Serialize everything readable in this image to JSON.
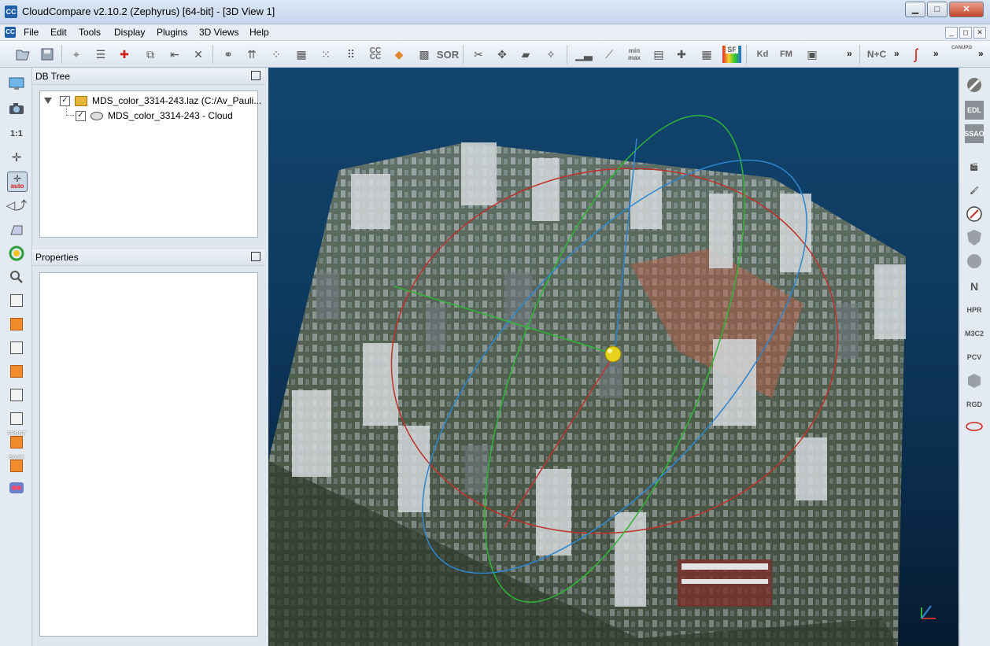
{
  "window": {
    "title": "CloudCompare v2.10.2 (Zephyrus) [64-bit] - [3D View 1]",
    "logo_text": "CC",
    "minimize": "▁",
    "maximize": "□",
    "close": "✕"
  },
  "menu": {
    "items": [
      "File",
      "Edit",
      "Tools",
      "Display",
      "Plugins",
      "3D Views",
      "Help"
    ],
    "mdi_minimize": "_",
    "mdi_restore": "◻",
    "mdi_close": "✕"
  },
  "toolbar": {
    "ccc_label": "CC CC",
    "sor_label": "SOR",
    "minmax_label": "min max",
    "sf_label": "SF",
    "kd_label": "Kd",
    "fm_label": "FM",
    "nc_label": "N+C",
    "canupo_label": "CANUPO",
    "more": "»"
  },
  "left_toolbar": {
    "ratio_label": "1:1",
    "auto_label": "auto",
    "front_label": "FRONT",
    "back_label": "BACK"
  },
  "db_tree": {
    "title": "DB Tree",
    "root": {
      "label": "MDS_color_3314-243.laz (C:/Av_Pauli...",
      "checked": true
    },
    "child": {
      "label": "MDS_color_3314-243 - Cloud",
      "checked": true
    }
  },
  "properties": {
    "title": "Properties"
  },
  "right_toolbar": {
    "edl_label": "EDL",
    "ssao_label": "SSAO",
    "north_label": "N",
    "hpr_label": "HPR",
    "m3c2_label": "M3C2",
    "pcv_label": "PCV",
    "rgd_label": "RGD"
  },
  "colors": {
    "view_bg_top": "#12456f",
    "view_bg_bottom": "#061a30",
    "trihedron_red": "#c0302a",
    "trihedron_green": "#2fb535",
    "trihedron_blue": "#2e86cf",
    "pivot": "#e6d21a"
  }
}
